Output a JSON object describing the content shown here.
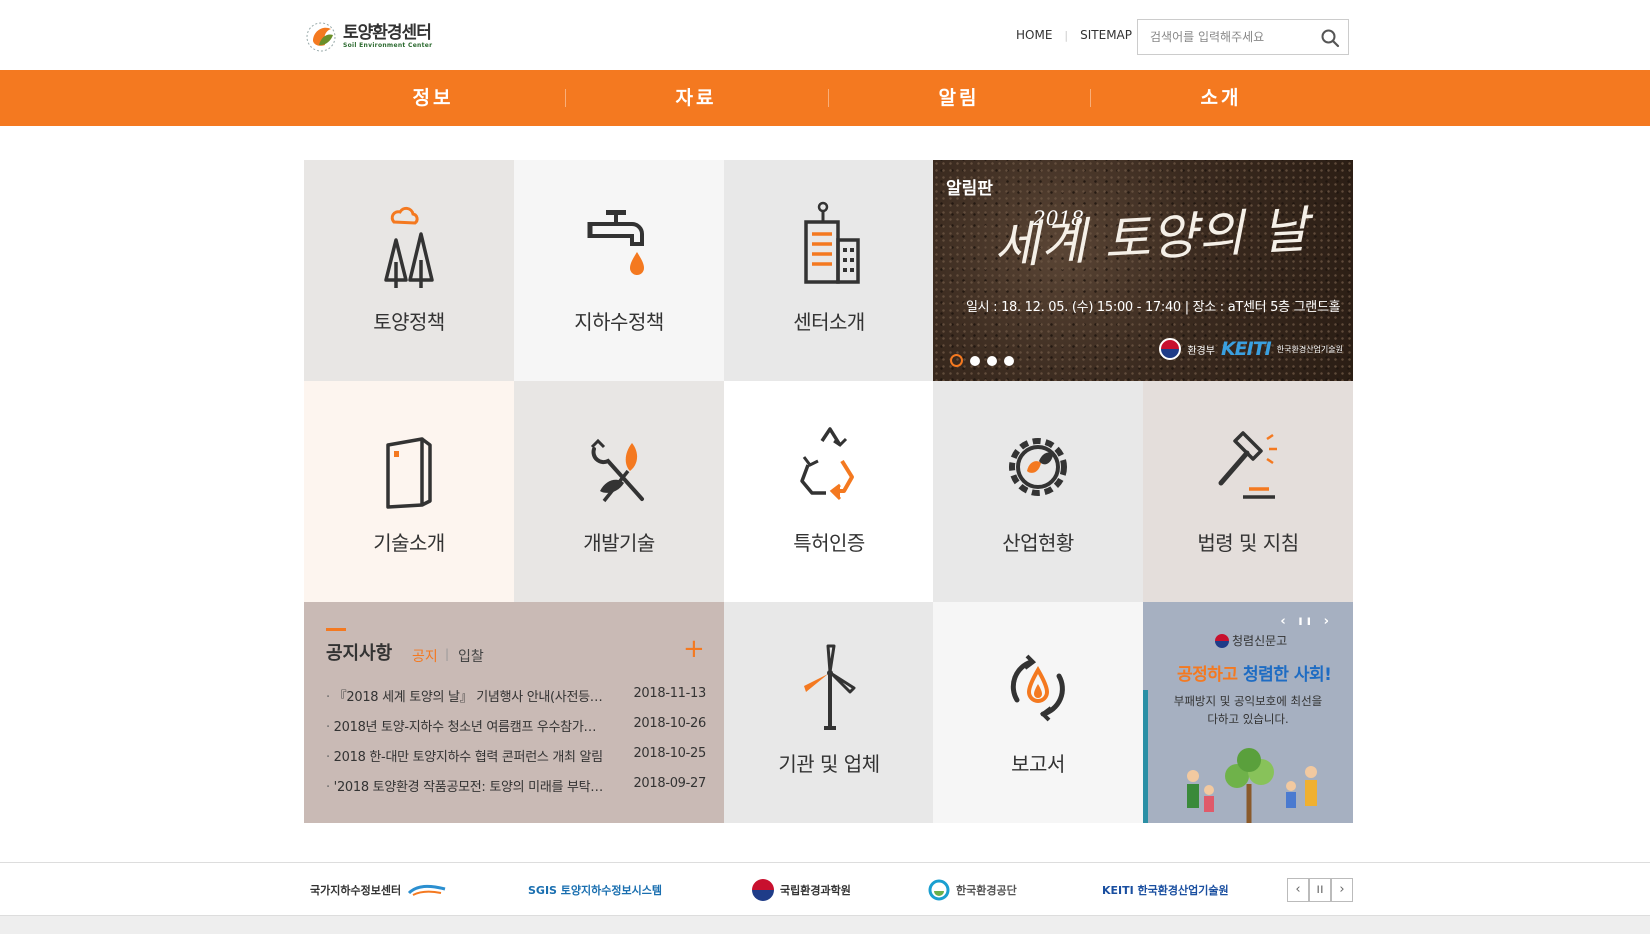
{
  "header": {
    "logo_kr": "토양환경센터",
    "logo_en": "Soil Environment Center",
    "home": "HOME",
    "sitemap": "SITEMAP",
    "search_placeholder": "검색어를 입력해주세요"
  },
  "gnb": [
    "정보",
    "자료",
    "알림",
    "소개"
  ],
  "tiles": {
    "soil_policy": "토양정책",
    "groundwater_policy": "지하수정책",
    "center_intro": "센터소개",
    "tech_intro": "기술소개",
    "dev_tech": "개발기술",
    "patent": "특허인증",
    "industry": "산업현황",
    "law": "법령 및 지침",
    "orgs": "기관 및 업체",
    "report": "보고서"
  },
  "banner": {
    "label": "알림판",
    "year": "2018",
    "title": "세계 토양의 날",
    "info": "일시 : 18. 12. 05. (수) 15:00 - 17:40 | 장소 : aT센터 5층 그랜드홀",
    "ministry": "환경부",
    "keiti": "KEITI",
    "keiti_sub": "한국환경산업기술원",
    "slide_count": 4,
    "active_slide": 1
  },
  "notice": {
    "title": "공지사항",
    "tab_active": "공지",
    "tab_other": "입찰",
    "plus": "+",
    "items": [
      {
        "title": "『2018 세계 토양의 날』 기념행사 안내(사전등…",
        "date": "2018-11-13"
      },
      {
        "title": "2018년 토양-지하수 청소년 여름캠프 우수참가…",
        "date": "2018-10-26"
      },
      {
        "title": "2018 한-대만 토양지하수 협력 콘퍼런스 개최 알림",
        "date": "2018-10-25"
      },
      {
        "title": "'2018 토양환경 작품공모전: 토양의 미래를 부탁…",
        "date": "2018-09-27"
      }
    ]
  },
  "popup": {
    "nav": "‹ ıı ›",
    "brand": "청렴신문고",
    "head_orange": "공정하고",
    "head_blue": "청렴한 사회!",
    "sub": "부패방지 및 공익보호에 최선을 다하고 있습니다."
  },
  "partners": [
    "국가지하수정보센터",
    "SGIS 토양지하수정보시스템",
    "국립환경과학원",
    "한국환경공단",
    "KEITI 한국환경산업기술원"
  ],
  "partner_controls": {
    "prev": "‹",
    "pause": "ıı",
    "next": "›"
  },
  "colors": {
    "accent": "#f47920",
    "tile_gray": "#e6e6e6",
    "tile_light": "#f5f5f5",
    "tile_cream": "#fcf4ee",
    "notice_bg": "#c9bab5"
  }
}
